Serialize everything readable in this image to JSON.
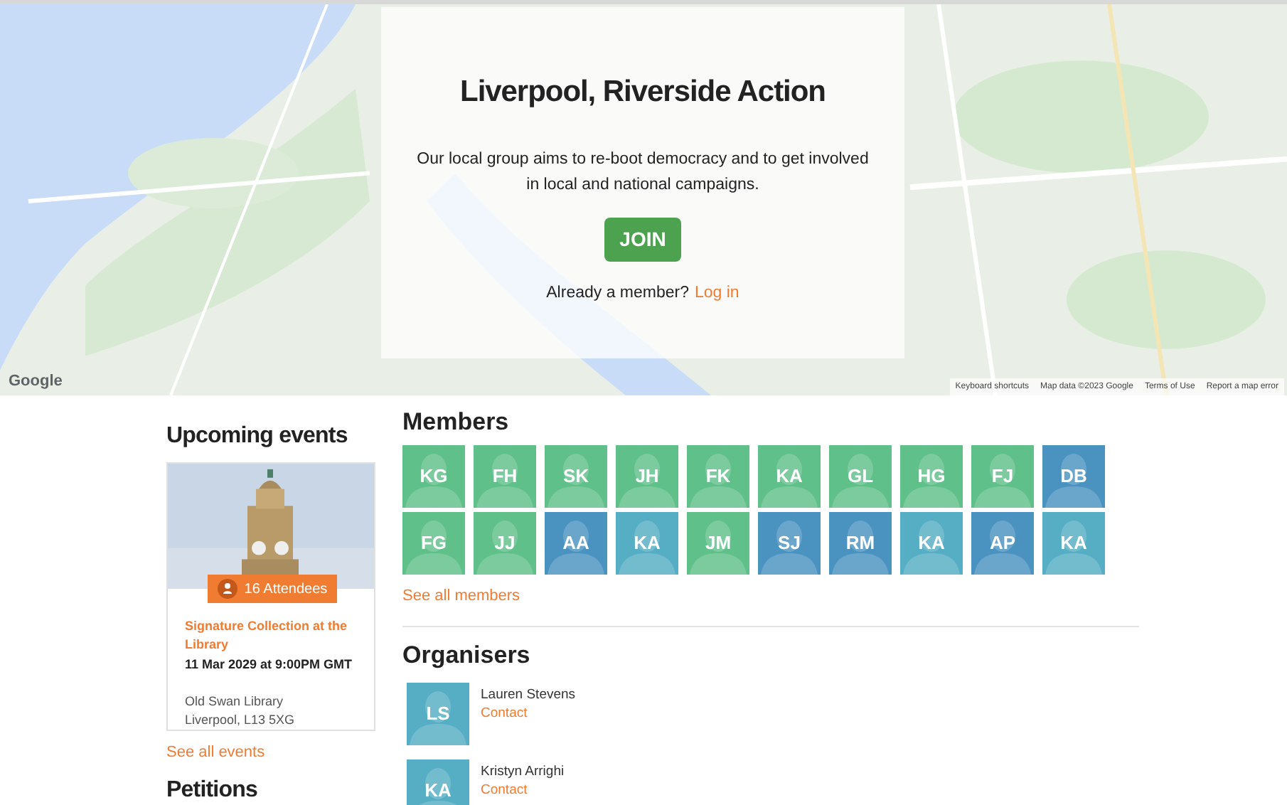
{
  "hero": {
    "title": "Liverpool, Riverside Action",
    "description": "Our local group aims to re-boot democracy and to get involved in local and national campaigns.",
    "join_button": "JOIN",
    "login_prompt": "Already a member?",
    "login_link": "Log in"
  },
  "map": {
    "logo": "Google",
    "attribution": [
      "Keyboard shortcuts",
      "Map data ©2023 Google",
      "Terms of Use",
      "Report a map error"
    ]
  },
  "events": {
    "title": "Upcoming events",
    "items": [
      {
        "attendees": "16 Attendees",
        "name": "Signature Collection at the Library",
        "date": "11 Mar 2029 at 9:00PM GMT",
        "venue": "Old Swan Library",
        "address": "Liverpool, L13 5XG"
      }
    ],
    "see_all": "See all events"
  },
  "petitions": {
    "title": "Petitions"
  },
  "members": {
    "title": "Members",
    "items": [
      {
        "initials": "KG",
        "color": "#5fc08a"
      },
      {
        "initials": "FH",
        "color": "#5fc08a"
      },
      {
        "initials": "SK",
        "color": "#5fc08a"
      },
      {
        "initials": "JH",
        "color": "#5fc08a"
      },
      {
        "initials": "FK",
        "color": "#5fc08a"
      },
      {
        "initials": "KA",
        "color": "#5fc08a"
      },
      {
        "initials": "GL",
        "color": "#5fc08a"
      },
      {
        "initials": "HG",
        "color": "#5fc08a"
      },
      {
        "initials": "FJ",
        "color": "#5fc08a"
      },
      {
        "initials": "DB",
        "color": "#4a93c0"
      },
      {
        "initials": "FG",
        "color": "#5fc08a"
      },
      {
        "initials": "JJ",
        "color": "#5fc08a"
      },
      {
        "initials": "AA",
        "color": "#4a93c0"
      },
      {
        "initials": "KA",
        "color": "#55aec4"
      },
      {
        "initials": "JM",
        "color": "#5fc08a"
      },
      {
        "initials": "SJ",
        "color": "#4a93c0"
      },
      {
        "initials": "RM",
        "color": "#4a93c0"
      },
      {
        "initials": "KA",
        "color": "#55aec4"
      },
      {
        "initials": "AP",
        "color": "#4a93c0"
      },
      {
        "initials": "KA",
        "color": "#55aec4"
      }
    ],
    "see_all": "See all members"
  },
  "organisers": {
    "title": "Organisers",
    "items": [
      {
        "initials": "LS",
        "color": "#55aec4",
        "name": "Lauren Stevens",
        "contact": "Contact"
      },
      {
        "initials": "KA",
        "color": "#55aec4",
        "name": "Kristyn Arrighi",
        "contact": "Contact"
      }
    ]
  }
}
